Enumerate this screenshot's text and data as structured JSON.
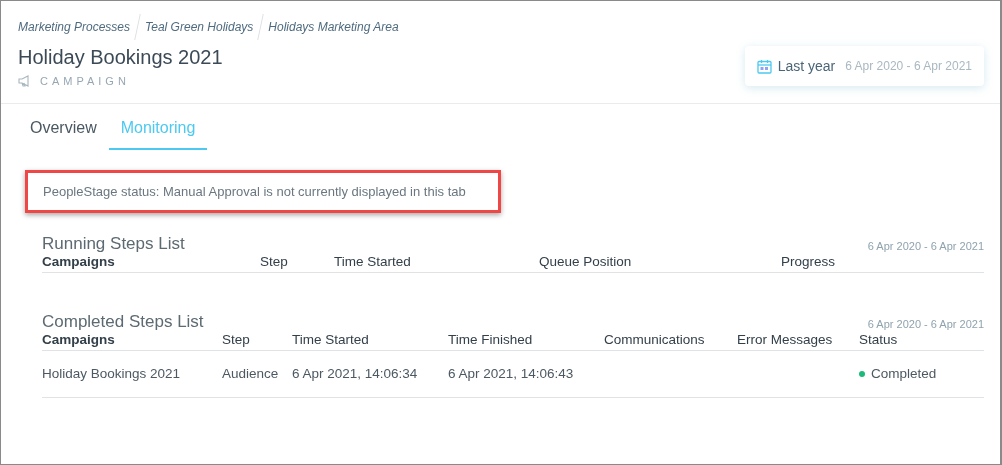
{
  "breadcrumbs": [
    "Marketing Processes",
    "Teal Green Holidays",
    "Holidays Marketing Area"
  ],
  "title": "Holiday Bookings 2021",
  "type_label": "CAMPAIGN",
  "date_filter": {
    "label": "Last year",
    "range": "6 Apr 2020 - 6 Apr 2021"
  },
  "tabs": [
    {
      "label": "Overview",
      "selected": false
    },
    {
      "label": "Monitoring",
      "selected": true
    }
  ],
  "notice": "PeopleStage status: Manual Approval is not currently displayed in this tab",
  "running_steps": {
    "title": "Running Steps List",
    "date_range": "6 Apr 2020 - 6 Apr 2021",
    "columns": [
      "Campaigns",
      "Step",
      "Time Started",
      "Queue Position",
      "Progress"
    ]
  },
  "completed_steps": {
    "title": "Completed Steps List",
    "date_range": "6 Apr 2020 - 6 Apr 2021",
    "columns": [
      "Campaigns",
      "Step",
      "Time Started",
      "Time Finished",
      "Communications",
      "Error Messages",
      "Status"
    ],
    "rows": [
      {
        "cells": [
          "Holiday Bookings 2021",
          "Audience",
          "6 Apr 2021, 14:06:34",
          "6 Apr 2021, 14:06:43",
          "",
          ""
        ],
        "status": {
          "text": "Completed",
          "color": "#1bb97a"
        }
      }
    ]
  }
}
